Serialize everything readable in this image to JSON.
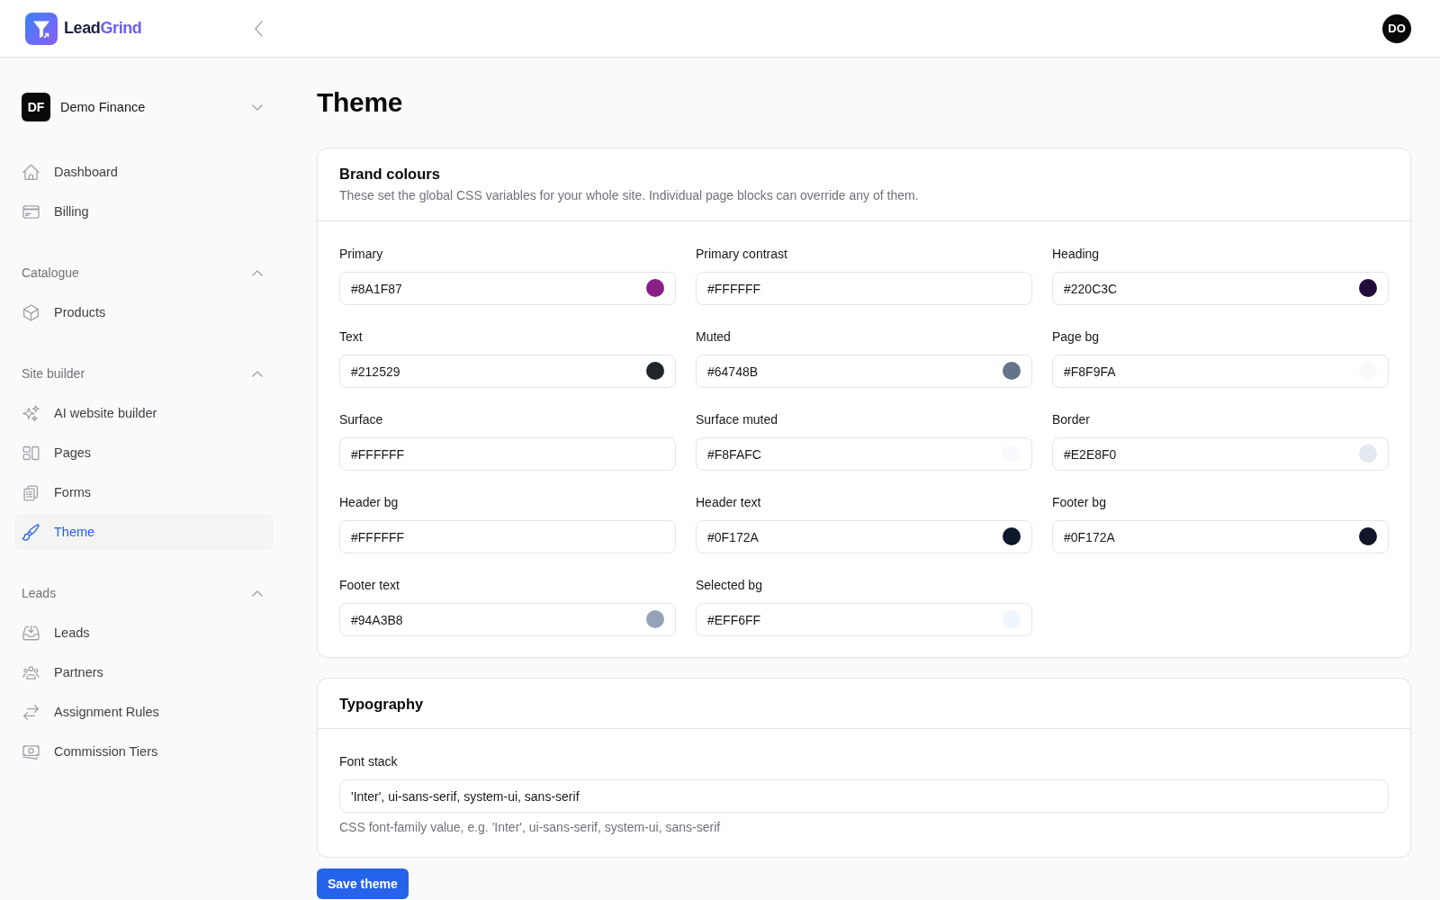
{
  "header": {
    "brand": {
      "name_start": "Lead",
      "name_end": "Grind"
    },
    "avatar_initials": "DO"
  },
  "sidebar": {
    "workspace": {
      "initials": "DF",
      "name": "Demo Finance"
    },
    "groups": [
      {
        "items": [
          {
            "label": "Dashboard",
            "selected": false
          },
          {
            "label": "Billing",
            "selected": false
          }
        ]
      },
      {
        "title": "Catalogue",
        "expanded": true,
        "items": [
          {
            "label": "Products",
            "selected": false
          }
        ]
      },
      {
        "title": "Site builder",
        "expanded": true,
        "items": [
          {
            "label": "AI website builder",
            "selected": false
          },
          {
            "label": "Pages",
            "selected": false
          },
          {
            "label": "Forms",
            "selected": false
          },
          {
            "label": "Theme",
            "selected": true
          }
        ]
      },
      {
        "title": "Leads",
        "expanded": true,
        "items": [
          {
            "label": "Leads",
            "selected": false
          },
          {
            "label": "Partners",
            "selected": false
          },
          {
            "label": "Assignment Rules",
            "selected": false
          },
          {
            "label": "Commission Tiers",
            "selected": false
          }
        ]
      }
    ]
  },
  "page_title": "Theme",
  "brand_colours": {
    "title": "Brand colours",
    "description": "These set the global CSS variables for your whole site. Individual page blocks can override any of them.",
    "fields": [
      {
        "label": "Primary",
        "value": "#8A1F87",
        "color": "#8a1f87"
      },
      {
        "label": "Primary contrast",
        "value": "#FFFFFF"
      },
      {
        "label": "Heading",
        "value": "#220C3C",
        "color": "#220c3c"
      },
      {
        "label": "Text",
        "value": "#212529",
        "color": "#212529"
      },
      {
        "label": "Muted",
        "value": "#64748B",
        "color": "#64748b"
      },
      {
        "label": "Page bg",
        "value": "#F8F9FA",
        "color": "#f8f9fa"
      },
      {
        "label": "Surface",
        "value": "#FFFFFF"
      },
      {
        "label": "Surface muted",
        "value": "#F8FAFC",
        "color": "#f8fafc"
      },
      {
        "label": "Border",
        "value": "#E2E8F0",
        "color": "#e2e8f0"
      },
      {
        "label": "Header bg",
        "value": "#FFFFFF"
      },
      {
        "label": "Header text",
        "value": "#0F172A",
        "color": "#0f172a"
      },
      {
        "label": "Footer bg",
        "value": "#0F172A",
        "color": "#0f172a"
      },
      {
        "label": "Footer text",
        "value": "#94A3B8",
        "color": "#94a3b8"
      },
      {
        "label": "Selected bg",
        "value": "#EFF6FF",
        "color": "#eff6ff"
      }
    ]
  },
  "typography": {
    "title": "Typography",
    "fields": [
      {
        "label": "Font stack",
        "value": "'Inter', ui-sans-serif, system-ui, sans-serif",
        "help": "CSS font-family value, e.g. 'Inter', ui-sans-serif, system-ui, sans-serif"
      }
    ]
  },
  "save_button": "Save theme"
}
